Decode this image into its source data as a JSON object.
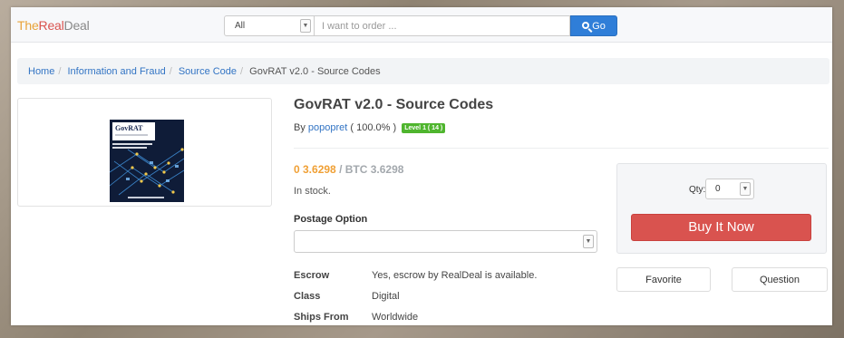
{
  "nav": {
    "brand_part1": "The",
    "brand_part2": "Real",
    "brand_part3": "Deal",
    "category_selected": "All",
    "search_placeholder": "I want to order ...",
    "go_label": "Go"
  },
  "breadcrumb": {
    "items": [
      "Home",
      "Information and Fraud",
      "Source Code"
    ],
    "current": "GovRAT v2.0 - Source Codes"
  },
  "product": {
    "title": "GovRAT v2.0 - Source Codes",
    "by_prefix": "By",
    "vendor": "popopret",
    "rating": "( 100.0% )",
    "level_badge": "Level 1 ( 14 )",
    "price_local": "0 3.6298",
    "price_sep": "/",
    "price_btc": "BTC 3.6298",
    "stock": "In stock.",
    "postage_label": "Postage Option",
    "postage_selected": "",
    "cover_title": "GovRAT",
    "specs": [
      {
        "key": "Escrow",
        "value": "Yes, escrow by RealDeal is available."
      },
      {
        "key": "Class",
        "value": "Digital"
      },
      {
        "key": "Ships From",
        "value": "Worldwide"
      }
    ]
  },
  "purchase": {
    "qty_label": "Qty:",
    "qty_value": "0",
    "buy_label": "Buy It Now",
    "favorite_label": "Favorite",
    "question_label": "Question"
  },
  "colors": {
    "accent_blue": "#2f7ed8",
    "buy_red": "#d9534f",
    "price_orange": "#f0a035",
    "badge_green": "#4fb52e"
  },
  "icons": {
    "search": "search-icon",
    "dropdown": "chevron-down-icon"
  }
}
